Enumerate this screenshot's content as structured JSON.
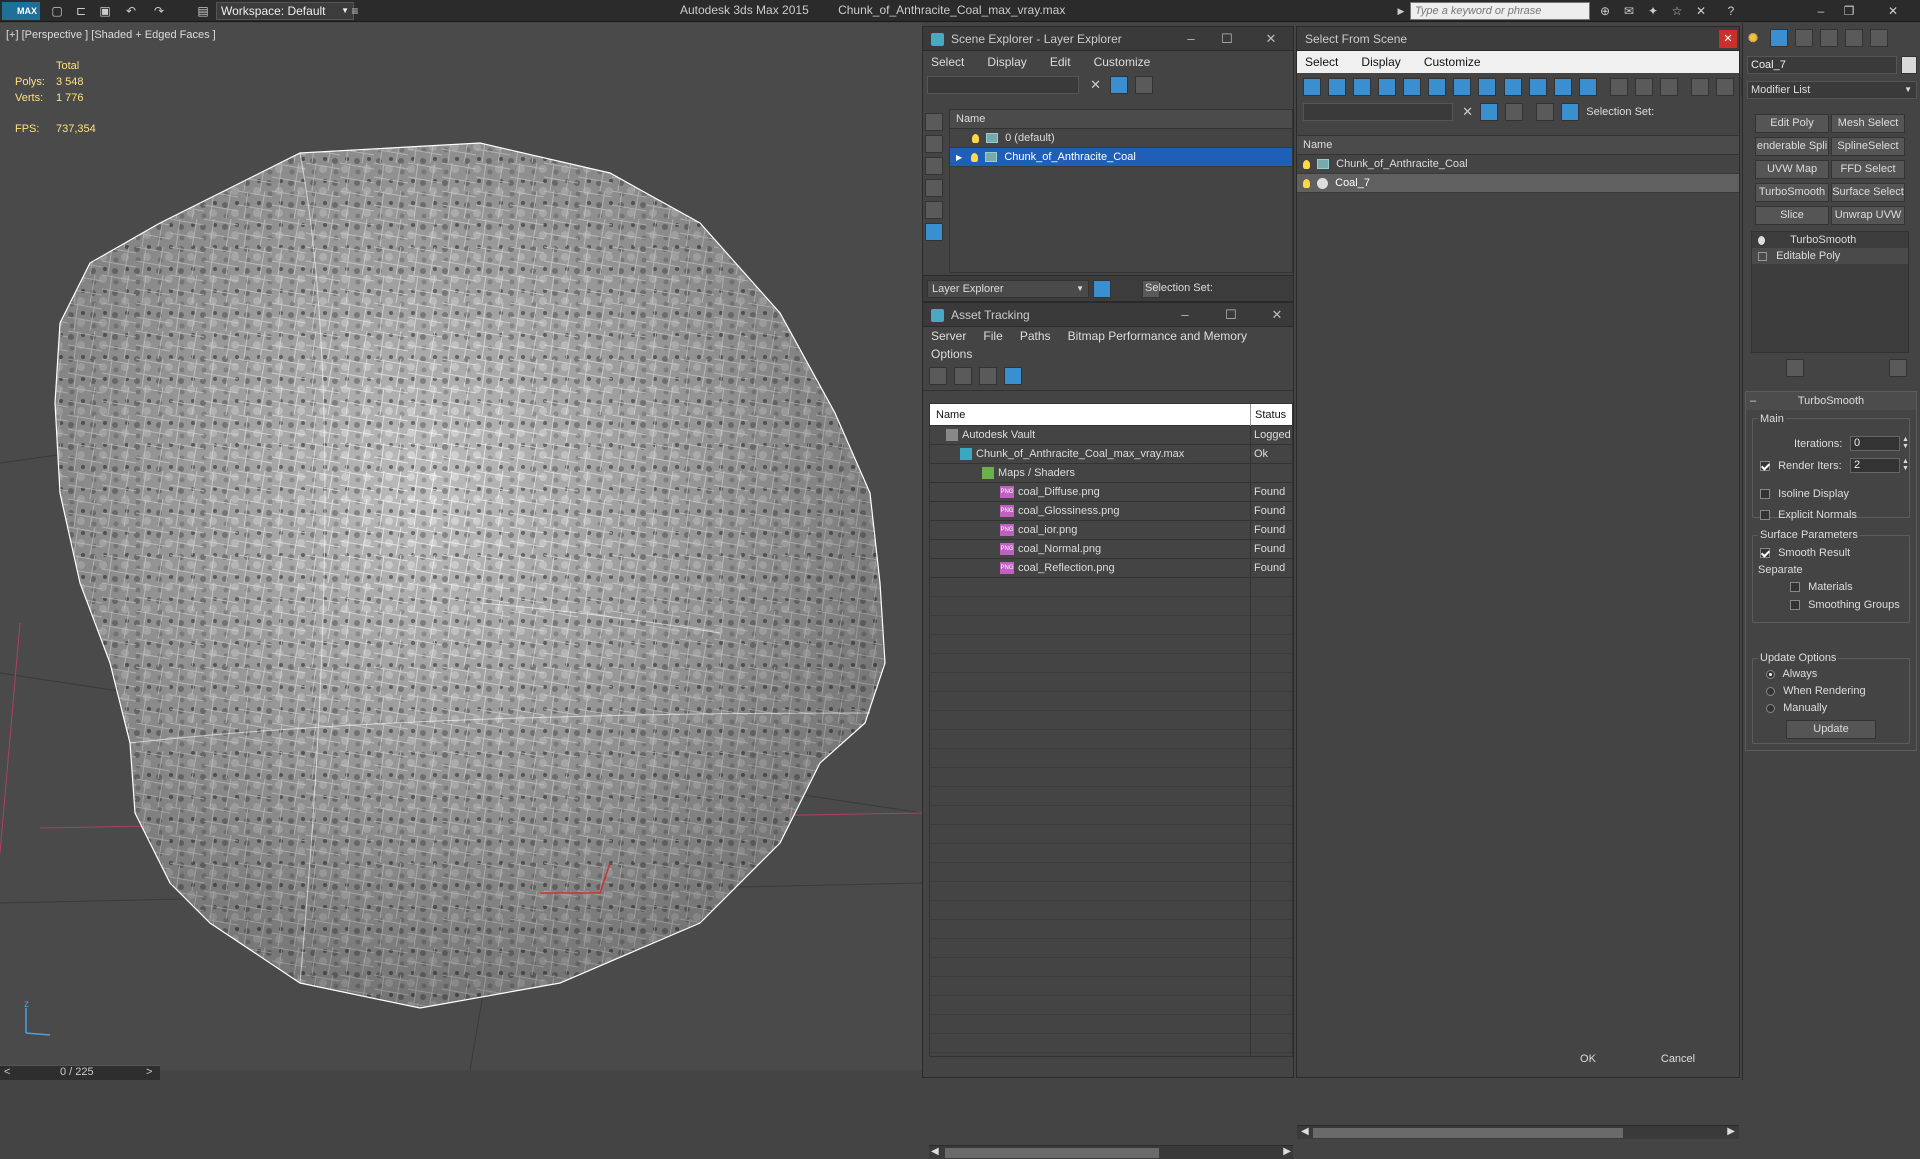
{
  "titlebar": {
    "max_logo": "MAX",
    "workspace": "Workspace: Default",
    "app_name": "Autodesk 3ds Max  2015",
    "file_name": "Chunk_of_Anthracite_Coal_max_vray.max",
    "search_placeholder": "Type a keyword or phrase"
  },
  "viewport": {
    "label": "[+] [Perspective ] [Shaded + Edged Faces ]",
    "stats": {
      "total_label": "Total",
      "polys_label": "Polys:",
      "polys_value": "3 548",
      "verts_label": "Verts:",
      "verts_value": "1 776",
      "fps_label": "FPS:",
      "fps_value": "737,354"
    },
    "axis_label": "z"
  },
  "timeline": {
    "prev": "<",
    "frame": "0 / 225",
    "next": ">"
  },
  "scene_explorer": {
    "title": "Scene Explorer - Layer Explorer",
    "menus": [
      "Select",
      "Display",
      "Edit",
      "Customize"
    ],
    "column_name": "Name",
    "rows": [
      {
        "name": "0 (default)"
      },
      {
        "name": "Chunk_of_Anthracite_Coal"
      }
    ],
    "footer_dropdown": "Layer Explorer",
    "footer_selection_set": "Selection Set:"
  },
  "asset_tracking": {
    "title": "Asset Tracking",
    "menus": [
      "Server",
      "File",
      "Paths",
      "Bitmap Performance and Memory",
      "Options"
    ],
    "col_name": "Name",
    "col_status": "Status",
    "rows": [
      {
        "name": "Autodesk Vault",
        "status": "Logged"
      },
      {
        "name": "Chunk_of_Anthracite_Coal_max_vray.max",
        "status": "Ok"
      },
      {
        "name": "Maps / Shaders",
        "status": ""
      },
      {
        "name": "coal_Diffuse.png",
        "status": "Found"
      },
      {
        "name": "coal_Glossiness.png",
        "status": "Found"
      },
      {
        "name": "coal_ior.png",
        "status": "Found"
      },
      {
        "name": "coal_Normal.png",
        "status": "Found"
      },
      {
        "name": "coal_Reflection.png",
        "status": "Found"
      }
    ]
  },
  "select_from_scene": {
    "title": "Select From Scene",
    "menus": [
      "Select",
      "Display",
      "Customize"
    ],
    "selection_set": "Selection Set:",
    "column_name": "Name",
    "rows": [
      {
        "name": "Chunk_of_Anthracite_Coal"
      },
      {
        "name": "Coal_7"
      }
    ],
    "ok": "OK",
    "cancel": "Cancel"
  },
  "command_panel": {
    "object_name": "Coal_7",
    "modifier_list": "Modifier List",
    "buttons": [
      "Edit Poly",
      "Mesh Select",
      "enderable Spli",
      "SplineSelect",
      "UVW Map",
      "FFD Select",
      "TurboSmooth",
      "Surface Select",
      "Slice",
      "Unwrap UVW"
    ],
    "stack": [
      "TurboSmooth",
      "Editable Poly"
    ],
    "rollout_title": "TurboSmooth",
    "main_label": "Main",
    "iterations_label": "Iterations:",
    "iterations_value": "0",
    "render_iters_label": "Render Iters:",
    "render_iters_value": "2",
    "isoline_label": "Isoline Display",
    "explicit_normals_label": "Explicit Normals",
    "surface_params_label": "Surface Parameters",
    "smooth_result_label": "Smooth Result",
    "separate_label": "Separate",
    "materials_label": "Materials",
    "smoothing_groups_label": "Smoothing Groups",
    "update_options_label": "Update Options",
    "always_label": "Always",
    "when_rendering_label": "When Rendering",
    "manually_label": "Manually",
    "update_button": "Update"
  }
}
